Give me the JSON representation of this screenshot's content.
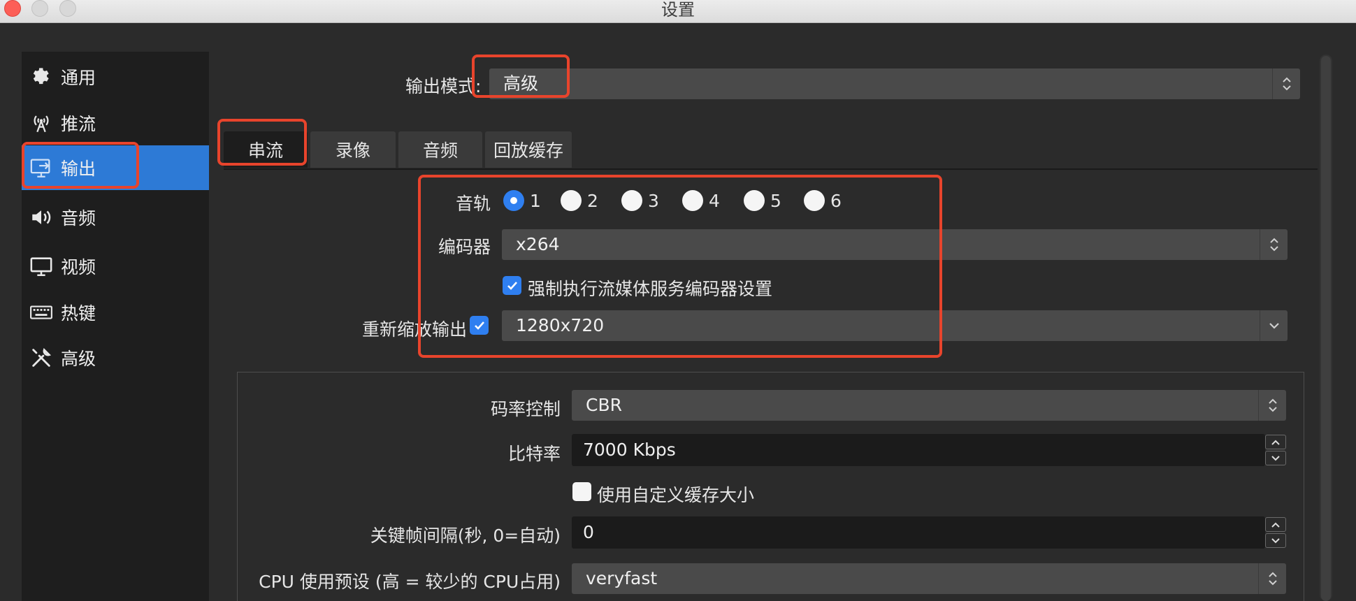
{
  "window": {
    "title": "设置"
  },
  "sidebar": {
    "items": [
      {
        "label": "通用",
        "icon": "gear-icon"
      },
      {
        "label": "推流",
        "icon": "antenna-icon"
      },
      {
        "label": "输出",
        "icon": "output-icon",
        "active": true
      },
      {
        "label": "音频",
        "icon": "speaker-icon"
      },
      {
        "label": "视频",
        "icon": "monitor-icon"
      },
      {
        "label": "热键",
        "icon": "keyboard-icon"
      },
      {
        "label": "高级",
        "icon": "tools-icon"
      }
    ]
  },
  "output_mode": {
    "label": "输出模式:",
    "value": "高级"
  },
  "tabs": [
    {
      "label": "串流",
      "active": true
    },
    {
      "label": "录像"
    },
    {
      "label": "音频"
    },
    {
      "label": "回放缓存"
    }
  ],
  "stream": {
    "audio_track": {
      "label": "音轨",
      "options": [
        "1",
        "2",
        "3",
        "4",
        "5",
        "6"
      ],
      "selected": "1"
    },
    "encoder": {
      "label": "编码器",
      "value": "x264"
    },
    "enforce_encoder": {
      "label": "强制执行流媒体服务编码器设置",
      "checked": true
    },
    "rescale": {
      "label": "重新缩放输出",
      "checked": true,
      "value": "1280x720"
    }
  },
  "encoder_settings": {
    "rate_control": {
      "label": "码率控制",
      "value": "CBR"
    },
    "bitrate": {
      "label": "比特率",
      "value": "7000 Kbps"
    },
    "custom_buffer": {
      "label": "使用自定义缓存大小",
      "checked": false
    },
    "keyframe": {
      "label": "关键帧间隔(秒, 0=自动)",
      "value": "0"
    },
    "cpu_preset": {
      "label": "CPU 使用预设 (高 = 较少的 CPU占用)",
      "value": "veryfast"
    }
  },
  "colors": {
    "accent": "#2d7ad6",
    "highlight": "#e8442c"
  }
}
